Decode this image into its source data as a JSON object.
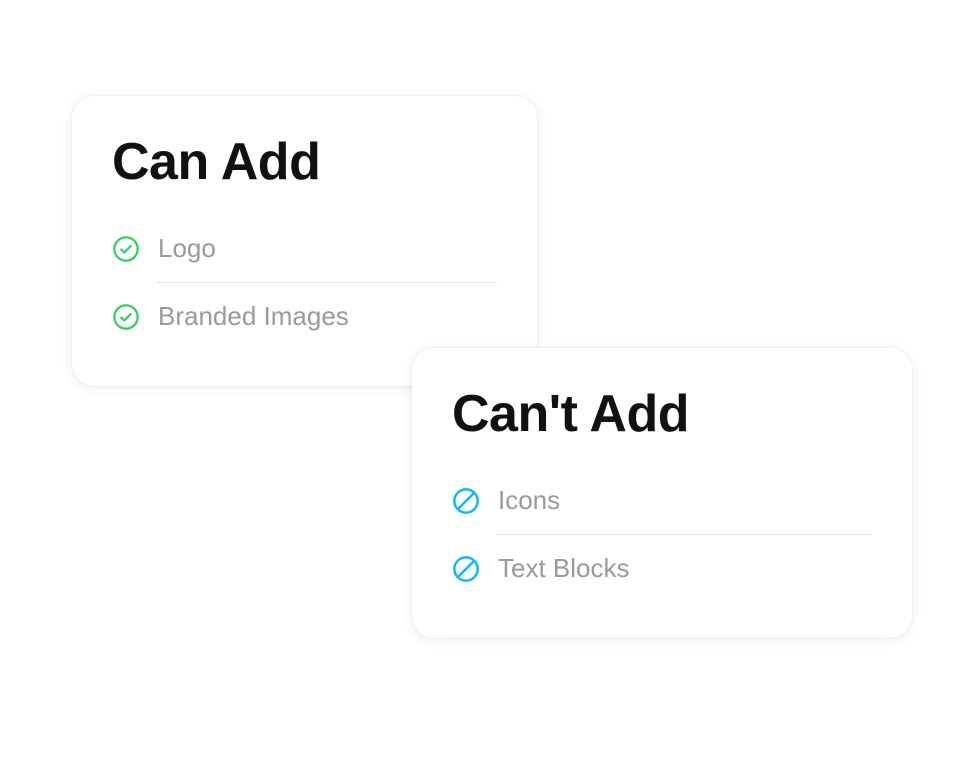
{
  "cards": {
    "can_add": {
      "title": "Can Add",
      "items": [
        {
          "label": "Logo"
        },
        {
          "label": "Branded Images"
        }
      ]
    },
    "cant_add": {
      "title": "Can't Add",
      "items": [
        {
          "label": "Icons"
        },
        {
          "label": "Text Blocks"
        }
      ]
    }
  },
  "colors": {
    "check": "#3dcc6a",
    "block": "#18b9f0"
  }
}
